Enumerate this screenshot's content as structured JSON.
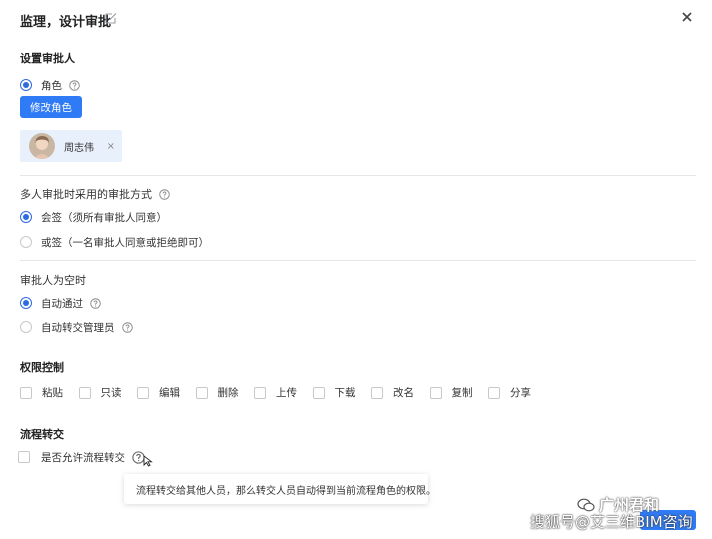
{
  "dialog": {
    "title": "监理，设计审批"
  },
  "approver": {
    "section_label": "设置审批人",
    "role_option": "角色",
    "modify_button": "修改角色",
    "chip_name": "周志伟",
    "chip_remove": "×"
  },
  "multi_approval": {
    "label": "多人审批时采用的审批方式",
    "options": [
      {
        "label": "会签（须所有审批人同意）",
        "selected": true
      },
      {
        "label": "或签（一名审批人同意或拒绝即可）",
        "selected": false
      }
    ]
  },
  "empty_approver": {
    "label": "审批人为空时",
    "options": [
      {
        "label": "自动通过",
        "selected": true
      },
      {
        "label": "自动转交管理员",
        "selected": false
      }
    ]
  },
  "permissions": {
    "section_label": "权限控制",
    "items": [
      "粘贴",
      "只读",
      "编辑",
      "删除",
      "上传",
      "下载",
      "改名",
      "复制",
      "分享"
    ]
  },
  "transfer": {
    "section_label": "流程转交",
    "checkbox_label": "是否允许流程转交",
    "tooltip": "流程转交给其他人员，那么转交人员自动得到当前流程角色的权限。"
  },
  "watermark": {
    "brand": "广州君和",
    "source": "搜狐号@艾三维BIM咨询"
  },
  "colors": {
    "accent": "#2f7bf5",
    "chip_bg": "#e8f0fc"
  }
}
